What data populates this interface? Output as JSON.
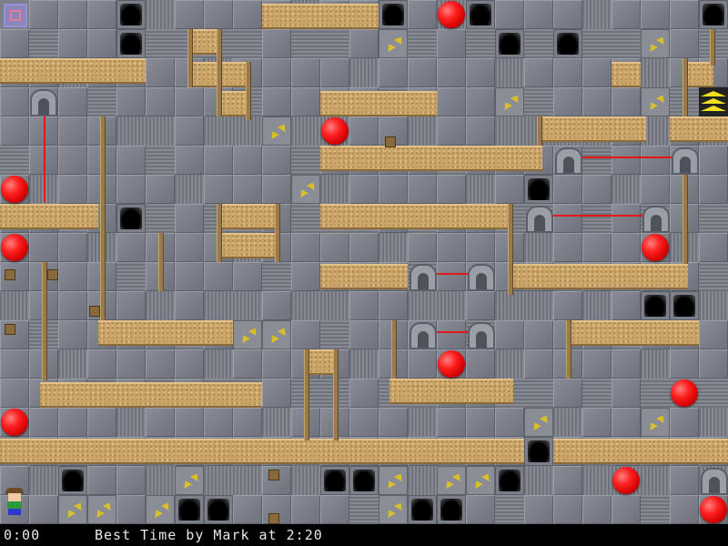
{
  "status": {
    "timer": "0:00",
    "best_time_text": "Best Time by Mark at 2:20"
  },
  "colors": {
    "floor_stone": "#7b7f89",
    "sand_wall": "#caa567",
    "ball": "#e01a1a",
    "laser_beam": "#e01a1a",
    "exit_chevrons": "#f0e020",
    "statusbar_bg": "#000000",
    "statusbar_text": "#e8e8e8"
  },
  "icons": {
    "start": "start-pad-icon",
    "exit": "exit-chevron-icon",
    "player": "player-character-icon",
    "ball": "red-ball-icon",
    "pit": "pit-hole-icon",
    "conveyor": "conveyor-arrows-icon",
    "laser": "laser-emitter-icon"
  }
}
